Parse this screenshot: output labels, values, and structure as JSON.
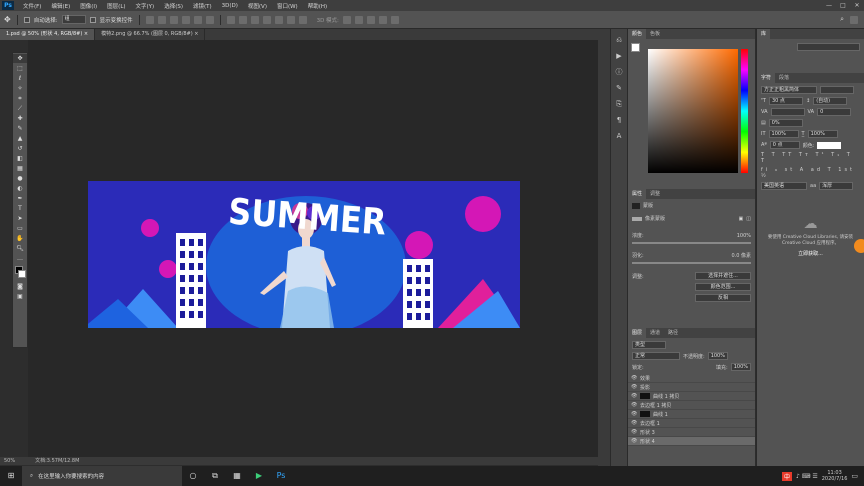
{
  "app": {
    "logo": "Ps"
  },
  "menu": [
    "文件(F)",
    "编辑(E)",
    "图像(I)",
    "图层(L)",
    "文字(Y)",
    "选择(S)",
    "滤镜(T)",
    "3D(D)",
    "视图(V)",
    "窗口(W)",
    "帮助(H)"
  ],
  "window_controls": [
    "—",
    "□",
    "✕"
  ],
  "options": {
    "auto_select_label": "自动选择:",
    "auto_select_value": "组",
    "show_transform_label": "显示变换控件",
    "mode_3d_label": "3D 模式:"
  },
  "tabs": [
    {
      "label": "1.psd @ 50% (形状 4, RGB/8#) ×",
      "active": true
    },
    {
      "label": "模特2.png @ 66.7% (图层 0, RGB/8#) ×",
      "active": false
    }
  ],
  "artwork": {
    "headline": "SUMMER",
    "bg_color": "#2b2bb8",
    "accent": "#d417b6"
  },
  "status": {
    "zoom": "50%",
    "doc": "文档:3.57M/12.8M"
  },
  "color_panel": {
    "tabs": [
      "颜色",
      "色板"
    ]
  },
  "properties_panel": {
    "tabs": [
      "属性",
      "调整"
    ],
    "mask_label": "蒙版",
    "pixel_mask": "像素蒙版",
    "density_label": "浓度:",
    "density_value": "100%",
    "feather_label": "羽化:",
    "feather_value": "0.0 像素",
    "adjust_label": "调整:",
    "select_subject_btn": "选择并遮住...",
    "color_range_btn": "颜色范围...",
    "invert_btn": "反相"
  },
  "layers_panel": {
    "tabs": [
      "图层",
      "通道",
      "路径"
    ],
    "filter_kind": "类型",
    "blend_mode": "正常",
    "opacity_label": "不透明度:",
    "opacity_value": "100%",
    "lock_label": "锁定:",
    "fill_label": "填充:",
    "fill_value": "100%",
    "layers": [
      {
        "name": "效果",
        "thumb": "none"
      },
      {
        "name": "投影",
        "thumb": "none"
      },
      {
        "name": "曲线 1 拷贝",
        "thumb": "black"
      },
      {
        "name": "去边框 1 拷贝",
        "thumb": "none"
      },
      {
        "name": "曲线 1",
        "thumb": "black"
      },
      {
        "name": "去边框 1",
        "thumb": "none"
      },
      {
        "name": "形状 3",
        "thumb": "none"
      },
      {
        "name": "形状 4",
        "thumb": "none"
      }
    ]
  },
  "char_panel": {
    "tabs": [
      "字符",
      "段落"
    ],
    "font_family": "方正正粗黑简体",
    "font_size": "30 点",
    "leading": "(自动)",
    "tracking": "0",
    "scale": "0%",
    "vscale": "100%",
    "hscale": "100%",
    "baseline": "0 点",
    "color_label": "颜色:",
    "language": "美国英语",
    "aa": "浑厚"
  },
  "library_panel": {
    "title": "库",
    "message": "要使用 Creative Cloud Libraries, 请安装 Creative Cloud 应用程序。",
    "link": "立即获取..."
  },
  "taskbar": {
    "search_placeholder": "在这里输入你要搜索的内容",
    "time": "11:03",
    "date": "2020/7/16",
    "ime": "中"
  }
}
